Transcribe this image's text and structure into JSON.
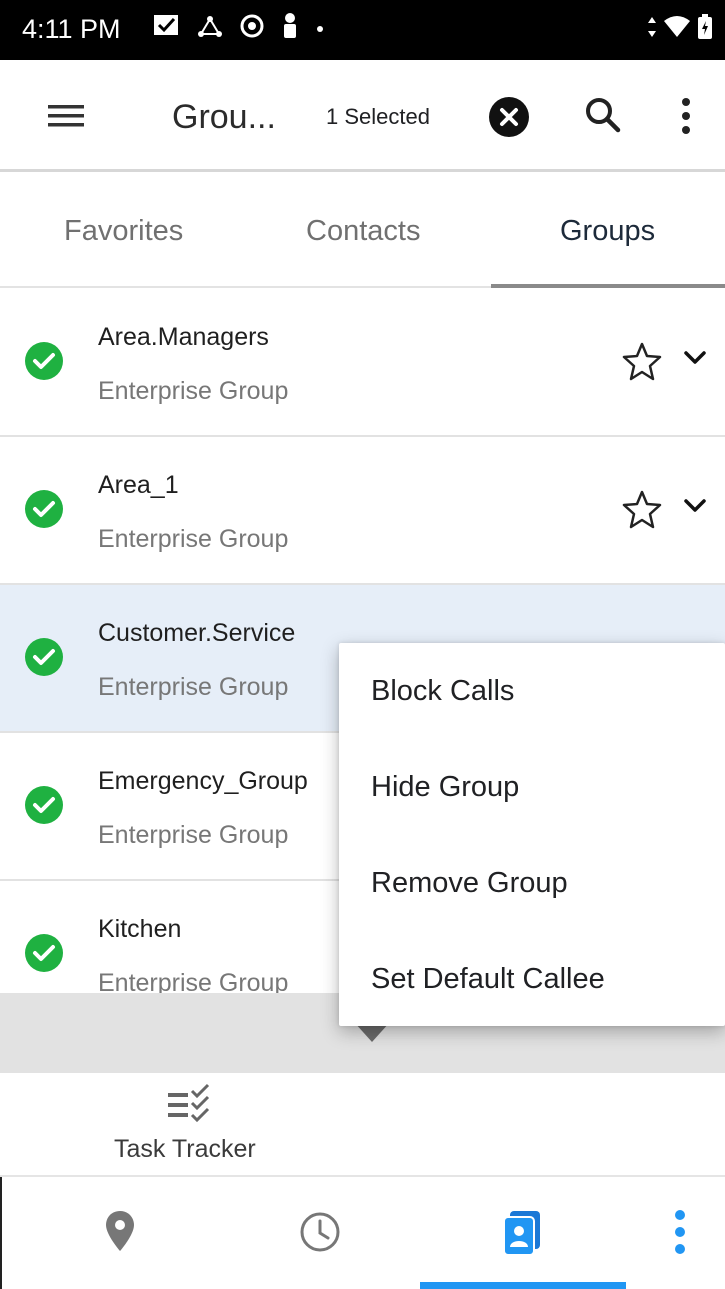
{
  "status_bar": {
    "time": "4:11 PM"
  },
  "app_bar": {
    "title": "Grou...",
    "selected_text": "1 Selected"
  },
  "tabs": [
    {
      "label": "Favorites",
      "active": false
    },
    {
      "label": "Contacts",
      "active": false
    },
    {
      "label": "Groups",
      "active": true
    }
  ],
  "groups": [
    {
      "name": "Area.Managers",
      "type": "Enterprise Group",
      "selected": false
    },
    {
      "name": "Area_1",
      "type": "Enterprise Group",
      "selected": false
    },
    {
      "name": "Customer.Service",
      "type": "Enterprise Group",
      "selected": true
    },
    {
      "name": "Emergency_Group",
      "type": "Enterprise Group",
      "selected": false
    },
    {
      "name": "Kitchen",
      "type": "Enterprise Group",
      "selected": false
    }
  ],
  "context_menu": {
    "items": [
      "Block Calls",
      "Hide Group",
      "Remove Group",
      "Set Default Callee"
    ]
  },
  "task_tracker": {
    "label": "Task Tracker"
  },
  "bottom_nav": {
    "items": [
      "location-icon",
      "recent-icon",
      "contacts-icon",
      "more-icon"
    ],
    "active_index": 2
  },
  "colors": {
    "check_green": "#1fb141",
    "nav_active": "#2196f3",
    "selected_row": "#e6eef8"
  }
}
